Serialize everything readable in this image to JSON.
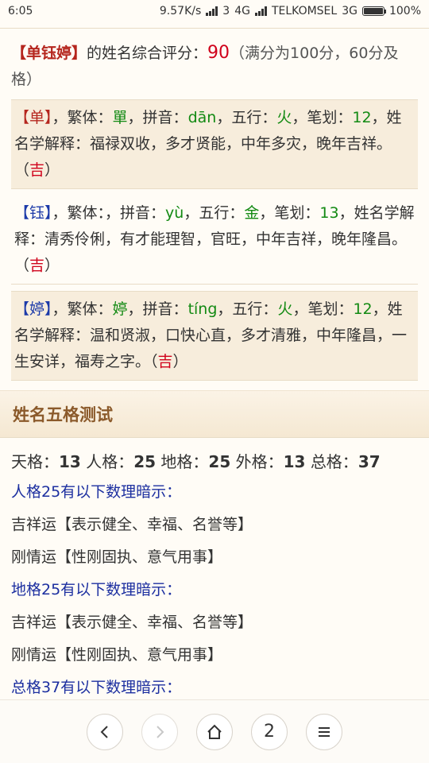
{
  "status": {
    "time": "6:05",
    "speed": "9.57K/s",
    "sim1": "3",
    "net1": "4G",
    "carrier": "TELKOMSEL",
    "net2": "3G",
    "battery": "100%"
  },
  "score": {
    "name": "【单钰婷】",
    "label": "的姓名综合评分：",
    "value": "90",
    "note": "（满分为100分，60分及格）"
  },
  "characters": [
    {
      "char": "【单】",
      "trad_label": "，繁体：",
      "trad": "單",
      "pinyin_label": "，拼音：",
      "pinyin": "dān",
      "wuxing_label": "，五行：",
      "wuxing": "火",
      "strokes_label": "，笔划：",
      "strokes": "12",
      "explain_label": "，姓名学解释：",
      "explain": "福禄双收，多才贤能，中年多灾，晚年吉祥。（",
      "luck": "吉",
      "close": "）"
    },
    {
      "char": "【钰】",
      "trad_label": "，繁体：",
      "trad": "",
      "pinyin_label": "，拼音：",
      "pinyin": "yù",
      "wuxing_label": "，五行：",
      "wuxing": "金",
      "strokes_label": "，笔划：",
      "strokes": "13",
      "explain_label": "，姓名学解释：",
      "explain": "清秀伶俐，有才能理智，官旺，中年吉祥，晚年隆昌。（",
      "luck": "吉",
      "close": "）"
    },
    {
      "char": "【婷】",
      "trad_label": "，繁体：",
      "trad": "婷",
      "pinyin_label": "，拼音：",
      "pinyin": "tíng",
      "wuxing_label": "，五行：",
      "wuxing": "火",
      "strokes_label": "，笔划：",
      "strokes": "12",
      "explain_label": "，姓名学解释：",
      "explain": "温和贤淑，口快心直，多才清雅，中年隆昌，一生安详，福寿之字。（",
      "luck": "吉",
      "close": "）"
    }
  ],
  "section_title": "姓名五格测试",
  "grids": {
    "tian_label": "天格：",
    "tian": "13",
    "ren_label": "人格：",
    "ren": "25",
    "di_label": "地格：",
    "di": "25",
    "wai_label": "外格：",
    "wai": "13",
    "zong_label": "总格：",
    "zong": "37"
  },
  "hints": [
    {
      "text": "人格25有以下数理暗示：",
      "style": "blue"
    },
    {
      "text": "吉祥运【表示健全、幸福、名誉等】",
      "style": "plain"
    },
    {
      "text": "刚情运【性刚固执、意气用事】",
      "style": "plain"
    },
    {
      "text": "地格25有以下数理暗示：",
      "style": "blue"
    },
    {
      "text": "吉祥运【表示健全、幸福、名誉等】",
      "style": "plain"
    },
    {
      "text": "刚情运【性刚固执、意气用事】",
      "style": "plain"
    },
    {
      "text": "总格37有以下数理暗示：",
      "style": "blue"
    }
  ],
  "nav": {
    "back_icon": "chevron-left-icon",
    "forward_icon": "chevron-right-icon",
    "home_icon": "home-icon",
    "tabs_count": "2",
    "menu_icon": "menu-icon"
  }
}
